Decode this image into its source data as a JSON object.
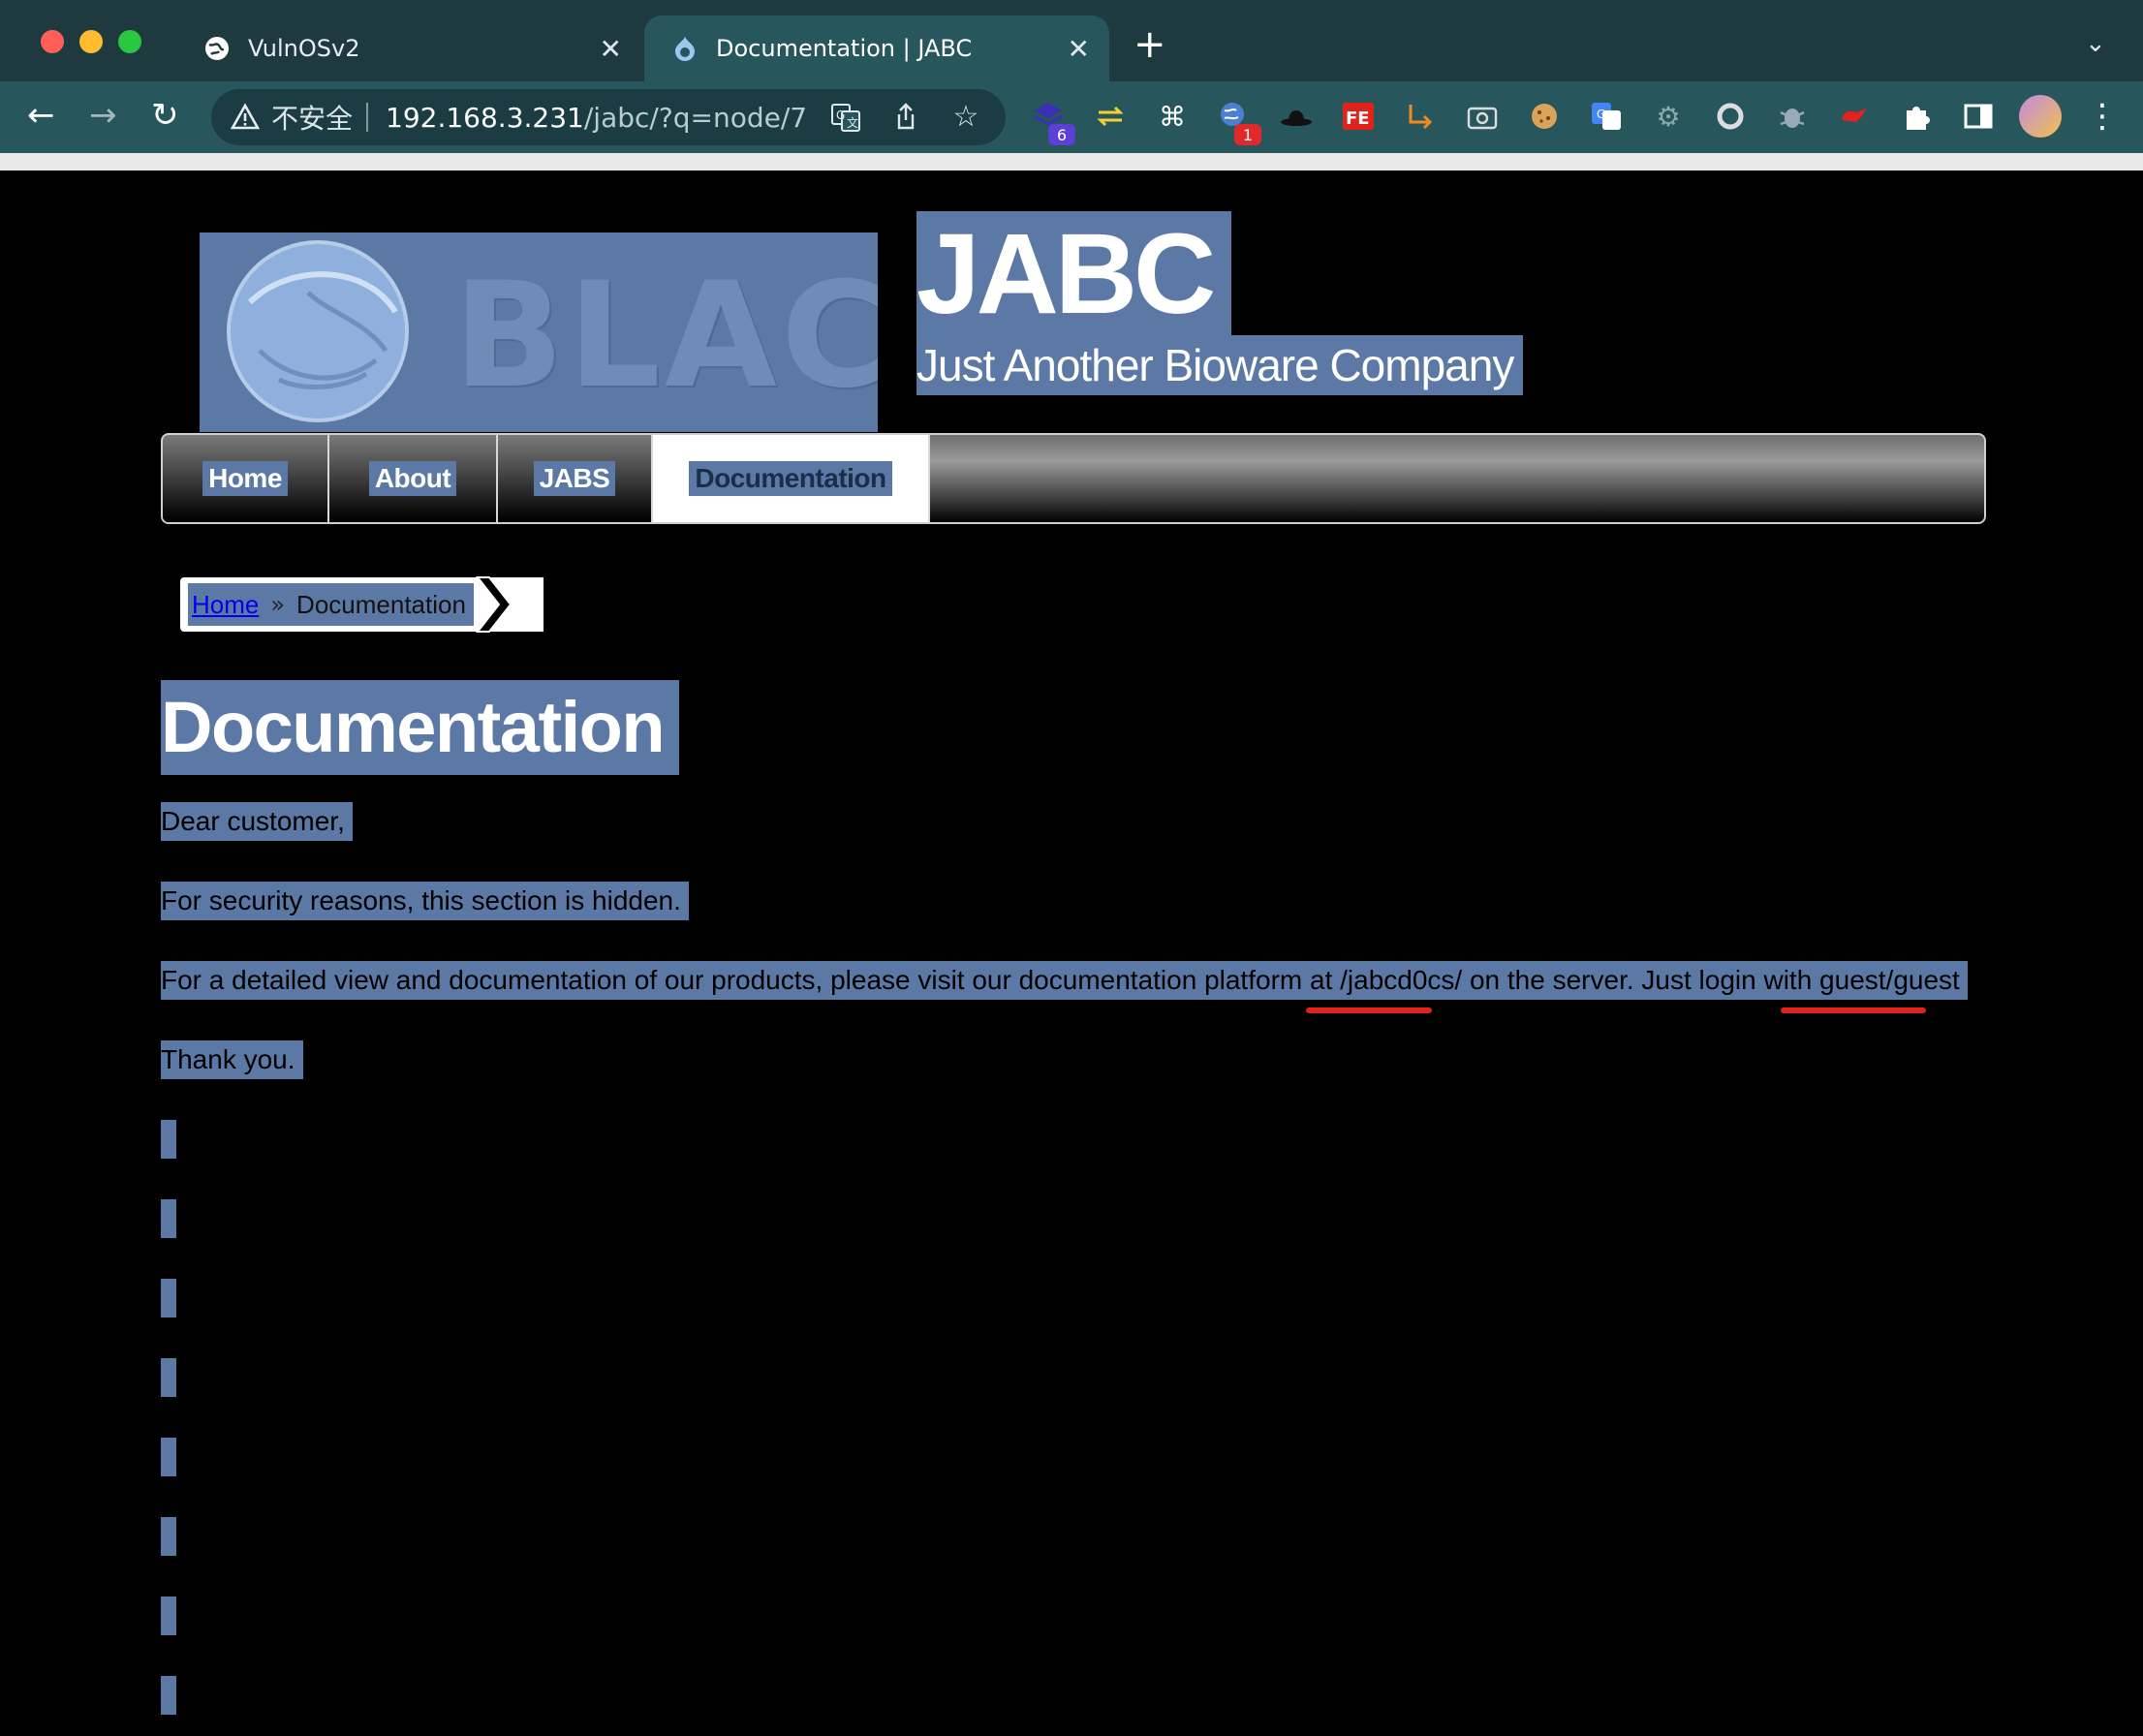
{
  "browser": {
    "tabs": [
      {
        "title": "VulnOSv2",
        "active": false
      },
      {
        "title": "Documentation | JABC",
        "active": true
      }
    ],
    "address": {
      "security_label": "不安全",
      "host": "192.168.3.231",
      "path": "/jabc/?q=node/7"
    },
    "extension_badges": {
      "first": "6",
      "second": "1"
    },
    "extension_icons": [
      "stack-icon",
      "swap-icon",
      "command-icon",
      "globe-icon",
      "hat-icon",
      "fe-icon",
      "arrow-icon",
      "camera-icon",
      "cookie-icon",
      "translate-icon",
      "gear-icon",
      "circle-icon",
      "bug-icon",
      "cloud-icon",
      "puzzle-icon",
      "sidebar-icon"
    ]
  },
  "site": {
    "logo_text": "BLACK",
    "name": "JABC",
    "slogan": "Just Another Bioware Company"
  },
  "menu": {
    "items": [
      {
        "label": "Home",
        "active": false
      },
      {
        "label": "About",
        "active": false
      },
      {
        "label": "JABS",
        "active": false
      },
      {
        "label": "Documentation",
        "active": true
      }
    ]
  },
  "breadcrumb": {
    "home": "Home",
    "separator": "»",
    "current": "Documentation"
  },
  "content": {
    "title": "Documentation",
    "paragraphs": [
      "Dear customer,",
      "For security reasons, this section is hidden.",
      "For a detailed view and documentation of our products, please visit our documentation platform at /jabcd0cs/ on the server. Just login with guest/guest",
      "Thank you."
    ]
  },
  "colors": {
    "selection": "#5c79a5",
    "chrome_tabbar": "#1e3a3f",
    "chrome_toolbar": "#27565d",
    "annotation_underline": "#e0231b"
  }
}
